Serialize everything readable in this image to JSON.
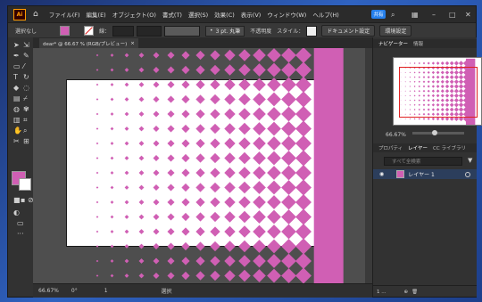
{
  "app": {
    "logo": "Ai",
    "home_icon": "home-icon",
    "share_label": "共有"
  },
  "menu": [
    "ファイル(F)",
    "編集(E)",
    "オブジェクト(O)",
    "書式(T)",
    "選択(S)",
    "効果(C)",
    "表示(V)",
    "ウィンドウ(W)",
    "ヘルプ(H)"
  ],
  "control": {
    "selection": "選択なし",
    "stroke_label": "線：",
    "stroke_style": "3 pt. 丸筆",
    "opacity_label": "不透明度",
    "style_label": "スタイル：",
    "doc_setup": "ドキュメント設定",
    "prefs": "環境設定"
  },
  "document": {
    "tab": "dear* @ 66.67 % (RGB/プレビュー)",
    "close": "×"
  },
  "status": {
    "zoom": "66.67%",
    "angle": "0°",
    "artboard": "1",
    "tool": "選択"
  },
  "panels": {
    "nav_tabs": [
      "ナビゲーター",
      "情報"
    ],
    "nav_zoom": "66.67%",
    "layer_tabs": [
      "プロパティ",
      "レイヤー",
      "CC ライブラリ"
    ],
    "search_placeholder": "すべて全検索",
    "layer_name": "レイヤー 1",
    "layer_count": "1 ..."
  },
  "colors": {
    "fill": "#d05fb4",
    "accent": "#2680eb"
  }
}
